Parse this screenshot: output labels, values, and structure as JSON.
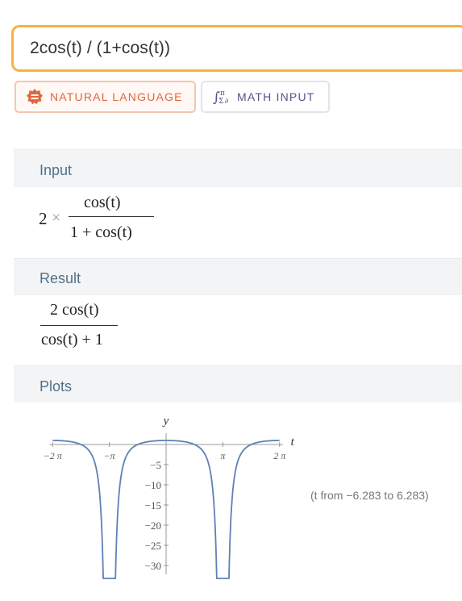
{
  "query": {
    "value": "2cos(t) / (1+cos(t))"
  },
  "modes": {
    "natural_label": "NATURAL LANGUAGE",
    "math_label": "MATH INPUT",
    "natural_icon": "equals-badge-icon",
    "math_icon": "math-symbols-icon"
  },
  "colors": {
    "accent": "#f7b33c",
    "natural": "#e0663e",
    "math": "#5d4e8c",
    "curve": "#5e81b5"
  },
  "pods": {
    "input": {
      "title": "Input",
      "coef": "2",
      "times": "×",
      "numerator": "cos(t)",
      "denominator": "1 + cos(t)"
    },
    "result": {
      "title": "Result",
      "numerator": "2 cos(t)",
      "denominator": "cos(t) + 1"
    },
    "plots": {
      "title": "Plots",
      "range_note": "(t from −6.283 to 6.283)"
    }
  },
  "chart_data": {
    "type": "line",
    "function": "2cos(t)/(1+cos(t))",
    "xlabel": "t",
    "ylabel": "y",
    "xlim": [
      -6.283,
      6.283
    ],
    "ylim": [
      -31,
      1.5
    ],
    "x_ticks": [
      {
        "value": -6.283,
        "label": "−2 π"
      },
      {
        "value": -3.1416,
        "label": "−π"
      },
      {
        "value": 3.1416,
        "label": "π"
      },
      {
        "value": 6.283,
        "label": "2 π"
      }
    ],
    "y_ticks": [
      {
        "value": -5,
        "label": "−5"
      },
      {
        "value": -10,
        "label": "−10"
      },
      {
        "value": -15,
        "label": "−15"
      },
      {
        "value": -20,
        "label": "−20"
      },
      {
        "value": -25,
        "label": "−25"
      },
      {
        "value": -30,
        "label": "−30"
      }
    ],
    "series": [
      {
        "values_description_free": true
      }
    ],
    "grid": false
  }
}
